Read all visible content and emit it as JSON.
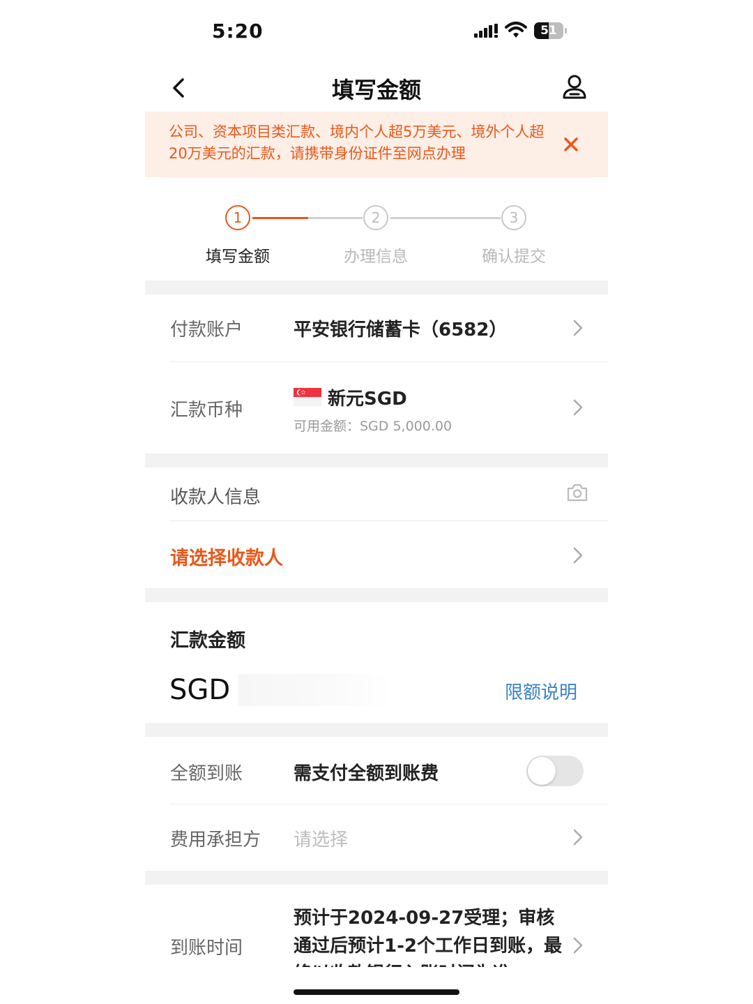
{
  "status_bar": {
    "time": "5:20",
    "battery_level": "51",
    "battery_fraction": 0.51
  },
  "nav": {
    "title": "填写金额",
    "back_icon": "chevron-left-icon",
    "profile_icon": "user-icon"
  },
  "notice": {
    "text": "公司、资本项目类汇款、境内个人超5万美元、境外个人超20万美元的汇款，请携带身份证件至网点办理",
    "close_icon": "close-icon",
    "color": "#e8581a",
    "background": "#fdeee6"
  },
  "steps": [
    {
      "number": "1",
      "label": "填写金额",
      "active": true
    },
    {
      "number": "2",
      "label": "办理信息",
      "active": false
    },
    {
      "number": "3",
      "label": "确认提交",
      "active": false
    }
  ],
  "payment_account": {
    "label": "付款账户",
    "value": "平安银行储蓄卡（6582）"
  },
  "currency": {
    "label": "汇款币种",
    "value": "新元SGD",
    "available": "可用金额：SGD 5,000.00",
    "flag_icon": "singapore-flag-icon"
  },
  "payee": {
    "section_title": "收款人信息",
    "camera_icon": "camera-icon",
    "select_label": "请选择收款人"
  },
  "amount": {
    "title": "汇款金额",
    "currency_code": "SGD",
    "input_value": "",
    "limit_link": "限额说明"
  },
  "full_arrival": {
    "label": "全额到账",
    "value": "需支付全额到账费",
    "toggle_on": false
  },
  "fee_bearer": {
    "label": "费用承担方",
    "placeholder": "请选择"
  },
  "arrival_time": {
    "label": "到账时间",
    "text": "预计于2024-09-27受理；审核通过后预计1-2个工作日到账，最终以收款银行入账时间为准"
  },
  "colors": {
    "accent": "#e8581a",
    "link": "#3a82c4",
    "muted": "#999999"
  }
}
